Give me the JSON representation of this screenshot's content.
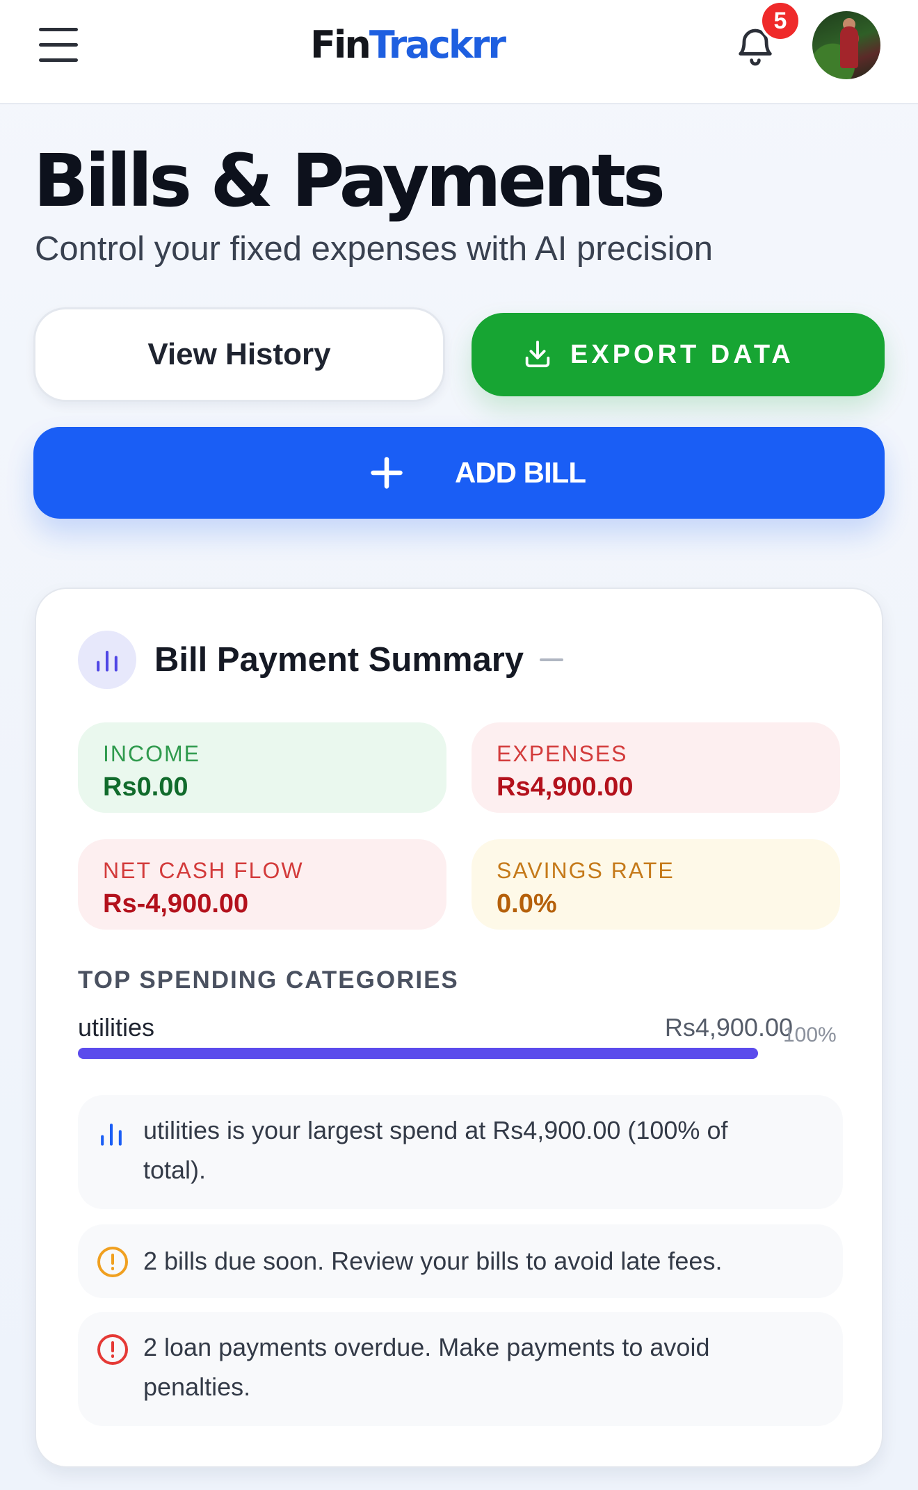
{
  "header": {
    "logo_part1": "Fin",
    "logo_part2": "Trackrr",
    "notification_count": "5"
  },
  "page": {
    "title": "Bills & Payments",
    "subtitle": "Control your fixed expenses with AI precision"
  },
  "actions": {
    "view_history_label": "View History",
    "export_label": "EXPORT DATA",
    "add_bill_label": "ADD BILL"
  },
  "summary": {
    "title": "Bill Payment Summary",
    "stats": {
      "income": {
        "label": "INCOME",
        "value": "Rs0.00"
      },
      "expenses": {
        "label": "EXPENSES",
        "value": "Rs4,900.00"
      },
      "net_cash_flow": {
        "label": "NET CASH FLOW",
        "value": "Rs-4,900.00"
      },
      "savings_rate": {
        "label": "SAVINGS RATE",
        "value": "0.0%"
      }
    },
    "top_categories_heading": "TOP SPENDING CATEGORIES",
    "categories": [
      {
        "name": "utilities",
        "amount": "Rs4,900.00",
        "percent_label": "100%",
        "share": 1.0
      }
    ],
    "insights": [
      {
        "icon": "bar-chart-icon",
        "text": "utilities is your largest spend at Rs4,900.00 (100% of total)."
      },
      {
        "icon": "warning-circle-icon",
        "text": "2 bills due soon. Review your bills to avoid late fees."
      },
      {
        "icon": "alert-circle-icon",
        "text": "2 loan payments overdue. Make payments to avoid penalties."
      }
    ]
  },
  "colors": {
    "brand_blue": "#1a5ef5",
    "export_green": "#17a533",
    "badge_red": "#ef2a2a",
    "category_bar": "#5b4bec"
  }
}
